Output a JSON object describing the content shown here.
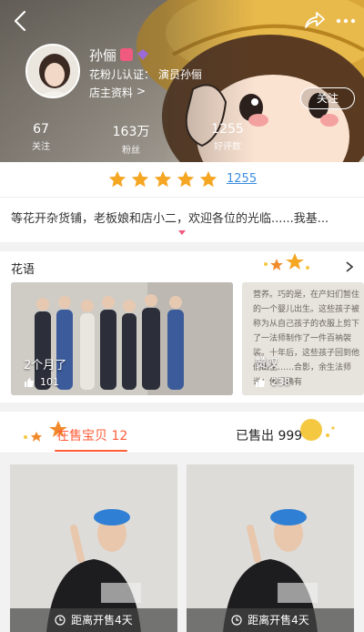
{
  "header": {
    "shop_name": "孙俪",
    "cert_label": "花粉儿认证：",
    "cert_name": "演员孙俪",
    "owner_info": "店主资料",
    "owner_arrow": ">",
    "follow_label": "关注",
    "stats": [
      {
        "value": "67",
        "label": "关注"
      },
      {
        "value": "163万",
        "label": "粉丝"
      },
      {
        "value": "1255",
        "label": "好评数"
      }
    ]
  },
  "rating": {
    "stars": 5,
    "count": "1255",
    "star_color": "#f5a623"
  },
  "description": {
    "text": "等花开杂货铺，老板娘和店小二，欢迎各位的光临......我基..."
  },
  "flower_section": {
    "title": "花语",
    "cards": [
      {
        "caption": "2个月了",
        "likes": "101"
      },
      {
        "caption": "赞叹",
        "likes": "238",
        "text": "营养。巧的是，在产妇们暂住的一个婴儿出生。这些孩子被称为从自己孩子的衣服上剪下了一法师制作了一件百衲袈裟。十年后，这些孩子回到他们出生……合影，余生法师说：佛门确有"
      }
    ]
  },
  "tabs": {
    "on_sale_label": "在售宝贝 12",
    "sold_label": "已售出 999",
    "active_color": "#ff5c38"
  },
  "products": [
    {
      "countdown": "距离开售4天"
    },
    {
      "countdown": "距离开售4天"
    }
  ],
  "icons": {
    "back": "back-icon",
    "share": "share-icon",
    "more": "more-icon",
    "thumb": "thumbs-up-icon",
    "clock": "clock-icon"
  },
  "colors": {
    "accent": "#f05a7e",
    "link": "#3a8de0"
  }
}
